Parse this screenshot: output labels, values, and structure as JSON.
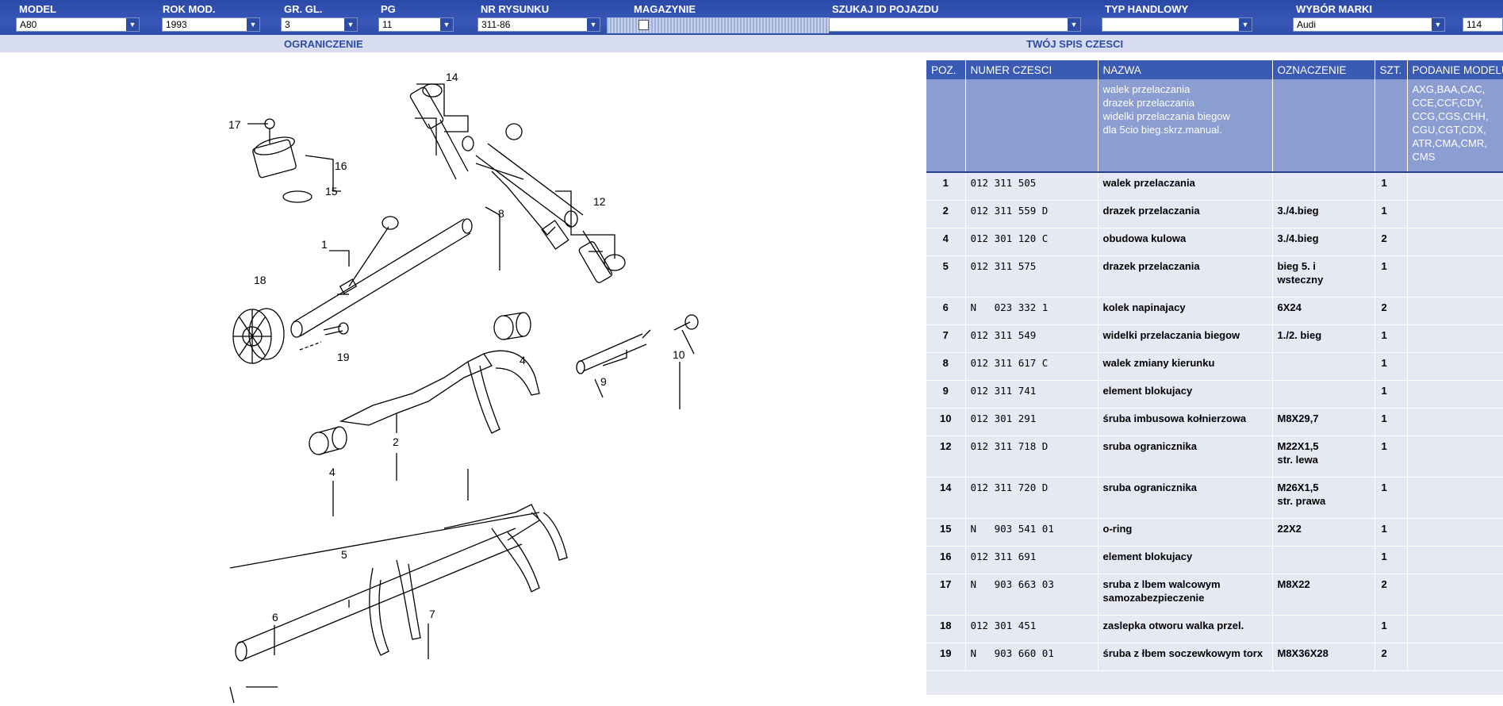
{
  "filters": [
    {
      "label": "MODEL",
      "value": "A80"
    },
    {
      "label": "ROK MOD.",
      "value": "1993"
    },
    {
      "label": "GR. GL.",
      "value": "3"
    },
    {
      "label": "PG",
      "value": "11"
    },
    {
      "label": "NR RYSUNKU",
      "value": "311-86"
    },
    {
      "label": "MAGAZYNIE",
      "checked": false
    },
    {
      "label": "SZUKAJ ID POJAZDU",
      "value": ""
    },
    {
      "label": "TYP HANDLOWY",
      "value": ""
    },
    {
      "label": "WYBÓR MARKI",
      "value": "Audi"
    }
  ],
  "extra_field": "114",
  "sub": {
    "left": "OGRANICZENIE",
    "right": "TWÓJ SPIS CZESCI"
  },
  "table": {
    "headers": [
      "POZ.",
      "NUMER CZESCI",
      "NAZWA",
      "OZNACZENIE",
      "SZT.",
      "PODANIE MODELU"
    ],
    "group_names": [
      "walek przelaczania",
      "drazek przelaczania",
      "widelki przelaczania biegow",
      "dla 5cio bieg.skrz.manual."
    ],
    "group_models": [
      "AXG,BAA,CAC,",
      "CCE,CCF,CDY,",
      "CCG,CGS,CHH,",
      "CGU,CGT,CDX,",
      "ATR,CMA,CMR,",
      "CMS"
    ],
    "rows": [
      {
        "pos": "1",
        "num": "012 311 505",
        "name": "walek przelaczania",
        "mark": "",
        "qty": "1"
      },
      {
        "pos": "2",
        "num": "012 311 559 D",
        "name": "drazek przelaczania",
        "mark": "3./4.bieg",
        "qty": "1"
      },
      {
        "pos": "4",
        "num": "012 301 120 C",
        "name": "obudowa kulowa",
        "mark": "3./4.bieg",
        "qty": "2"
      },
      {
        "pos": "5",
        "num": "012 311 575",
        "name": "drazek przelaczania",
        "mark": "bieg 5. i",
        "mark2": "wsteczny",
        "qty": "1"
      },
      {
        "pos": "6",
        "num": "N   023 332 1",
        "name": "kolek napinajacy",
        "mark": "6X24",
        "qty": "2"
      },
      {
        "pos": "7",
        "num": "012 311 549",
        "name": "widelki przelaczania biegow",
        "mark": "1./2. bieg",
        "qty": "1"
      },
      {
        "pos": "8",
        "num": "012 311 617 C",
        "name": "walek zmiany kierunku",
        "mark": "",
        "qty": "1"
      },
      {
        "pos": "9",
        "num": "012 311 741",
        "name": "element blokujacy",
        "mark": "",
        "qty": "1"
      },
      {
        "pos": "10",
        "num": "012 301 291",
        "name": "śruba imbusowa kołnierzowa",
        "mark": "M8X29,7",
        "qty": "1"
      },
      {
        "pos": "12",
        "num": "012 311 718 D",
        "name": "sruba ogranicznika",
        "mark": "M22X1,5",
        "mark2": "str. lewa",
        "qty": "1"
      },
      {
        "pos": "14",
        "num": "012 311 720 D",
        "name": "sruba ogranicznika",
        "mark": "M26X1,5",
        "mark2": "str. prawa",
        "qty": "1"
      },
      {
        "pos": "15",
        "num": "N   903 541 01",
        "name": "o-ring",
        "mark": "22X2",
        "qty": "1"
      },
      {
        "pos": "16",
        "num": "012 311 691",
        "name": "element blokujacy",
        "mark": "",
        "qty": "1"
      },
      {
        "pos": "17",
        "num": "N   903 663 03",
        "name": "sruba z lbem walcowym",
        "name2": "samozabezpieczenie",
        "mark": "M8X22",
        "qty": "2"
      },
      {
        "pos": "18",
        "num": "012 301 451",
        "name": "zaslepka otworu walka przel.",
        "mark": "",
        "qty": "1"
      },
      {
        "pos": "19",
        "num": "N   903 660 01",
        "name": "śruba z łbem soczewkowym torx",
        "mark": "M8X36X28",
        "qty": "2"
      }
    ]
  },
  "diagram": {
    "callouts": [
      "14",
      "17",
      "16",
      "15",
      "8",
      "12",
      "1",
      "18",
      "19",
      "4",
      "10",
      "9",
      "2",
      "4",
      "5",
      "6",
      "7"
    ]
  }
}
